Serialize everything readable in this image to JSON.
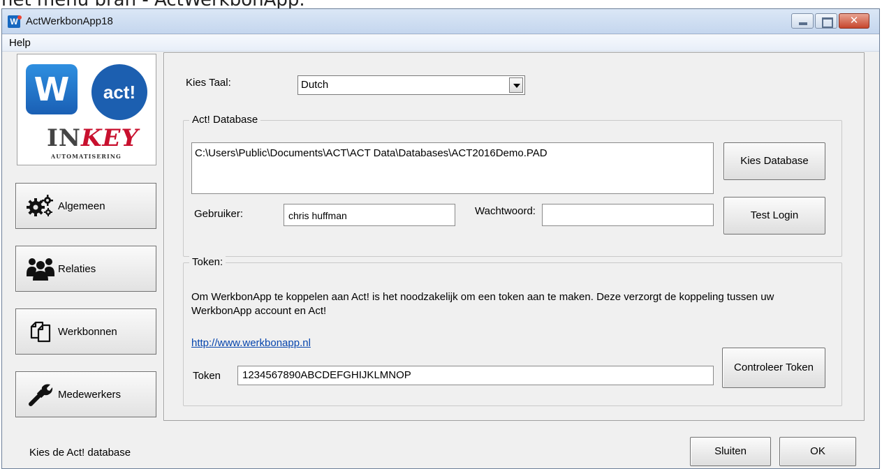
{
  "top_strip": {
    "text": "het menu bran - ActWerkbonApp."
  },
  "window": {
    "title": "ActWerkbonApp18",
    "icon_letter": "W",
    "close_glyph": "✕"
  },
  "menu": {
    "help": "Help"
  },
  "logo": {
    "w": "W",
    "act": "act!",
    "brand": "INKEY",
    "brand_prefix": "IN",
    "brand_suffix": "KEY",
    "sub": "AUTOMATISERING"
  },
  "nav": {
    "algemeen": "Algemeen",
    "relaties": "Relaties",
    "werkbonnen": "Werkbonnen",
    "medewerkers": "Medewerkers"
  },
  "language": {
    "label": "Kies Taal:",
    "selected": "Dutch"
  },
  "database": {
    "legend": "Act! Database",
    "path": "C:\\Users\\Public\\Documents\\ACT\\ACT Data\\Databases\\ACT2016Demo.PAD",
    "choose_button": "Kies Database",
    "user_label": "Gebruiker:",
    "user_value": "chris huffman",
    "password_label": "Wachtwoord:",
    "password_value": "",
    "test_button": "Test Login"
  },
  "token": {
    "legend": "Token:",
    "description": "Om WerkbonApp te koppelen aan Act! is het noodzakelijk om een token aan te maken. Deze verzorgt de koppeling tussen uw WerkbonApp account en Act!",
    "link": "http://www.werkbonapp.nl",
    "label": "Token",
    "value": "1234567890ABCDEFGHIJKLMNOP",
    "check_button": "Controleer Token"
  },
  "footer": {
    "status": "Kies de Act! database",
    "close_button": "Sluiten",
    "ok_button": "OK"
  }
}
